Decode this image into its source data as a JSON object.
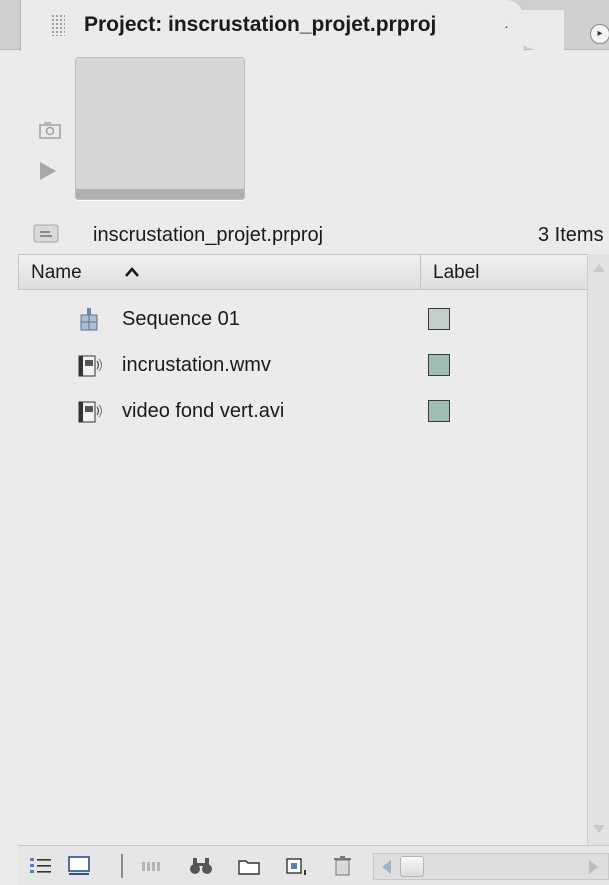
{
  "panel": {
    "title": "Project: inscrustation_projet.prproj",
    "close_glyph": "×",
    "menu_glyph": "▸"
  },
  "preview": {
    "camera_icon": "camera-icon",
    "play_icon": "play-icon"
  },
  "project_bar": {
    "file_name": "inscrustation_projet.prproj",
    "item_count": "3 Items"
  },
  "columns": {
    "name": "Name",
    "label": "Label"
  },
  "items": [
    {
      "name": "Sequence 01",
      "icon": "sequence-icon",
      "label_color": "#c3cfcb"
    },
    {
      "name": "incrustation.wmv",
      "icon": "video-clip-icon",
      "label_color": "#9fbfb6"
    },
    {
      "name": "video fond vert.avi",
      "icon": "video-clip-icon",
      "label_color": "#9fbfb6"
    }
  ],
  "toolbar": {
    "buttons": [
      "list-view-icon",
      "icon-view-icon",
      "automate-to-sequence-icon",
      "find-icon",
      "new-bin-icon",
      "new-item-icon",
      "delete-icon"
    ]
  },
  "colors": {
    "panel_bg": "#ebebeb",
    "tab_strip_bg": "#cfcfcf",
    "header_bg": "#e8e8e8",
    "scroll_arrow_active": "#9db4c8"
  }
}
